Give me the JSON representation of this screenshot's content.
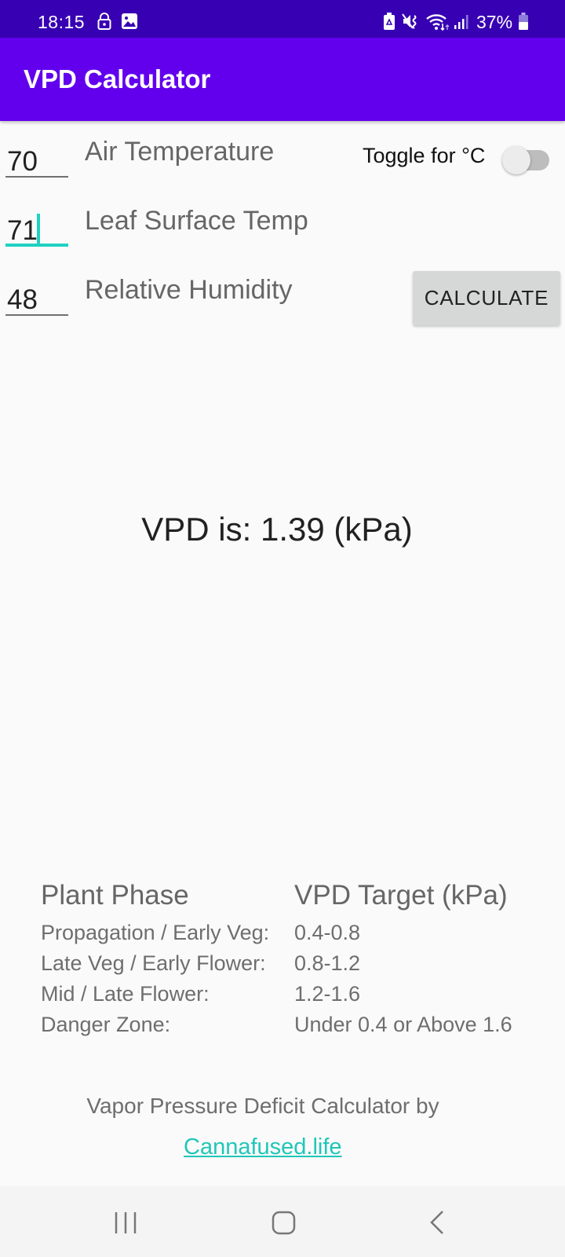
{
  "status_bar": {
    "time": "18:15",
    "left_icons": [
      "lock-icon",
      "image-icon"
    ],
    "right_icons": [
      "recycle-battery-icon",
      "mute-vibrate-icon",
      "wifi-icon",
      "signal-icon"
    ],
    "battery_percent": "37%",
    "battery_level": 0.37
  },
  "app_bar": {
    "title": "VPD Calculator",
    "color": "#6200ee"
  },
  "inputs": [
    {
      "id": "air-temperature",
      "value": "70",
      "label": "Air Temperature",
      "focused": false
    },
    {
      "id": "leaf-surface-temp",
      "value": "71",
      "label": "Leaf Surface Temp",
      "focused": true
    },
    {
      "id": "relative-humidity",
      "value": "48",
      "label": "Relative Humidity",
      "focused": false
    }
  ],
  "toggle": {
    "label": "Toggle for °C",
    "on": false
  },
  "calculate_button": {
    "label": "CALCULATE"
  },
  "result": {
    "text": "VPD is: 1.39 (kPa)"
  },
  "table": {
    "headers": [
      "Plant Phase",
      "VPD Target (kPa)"
    ],
    "rows": [
      {
        "phase": "Propagation / Early Veg:",
        "target": "0.4-0.8"
      },
      {
        "phase": "Late Veg / Early Flower:",
        "target": "0.8-1.2"
      },
      {
        "phase": "Mid / Late Flower:",
        "target": "1.2-1.6"
      },
      {
        "phase": "Danger Zone:",
        "target": "Under 0.4 or Above 1.6"
      }
    ]
  },
  "footer": {
    "credit_text": "Vapor Pressure Deficit Calculator by",
    "link_text": "Cannafused.life",
    "link_color": "#1fc7b8"
  },
  "nav_bar": {
    "buttons": [
      "recent-apps",
      "home",
      "back"
    ]
  },
  "colors": {
    "accent": "#1fd1c1",
    "status_bar": "#3700b3"
  }
}
